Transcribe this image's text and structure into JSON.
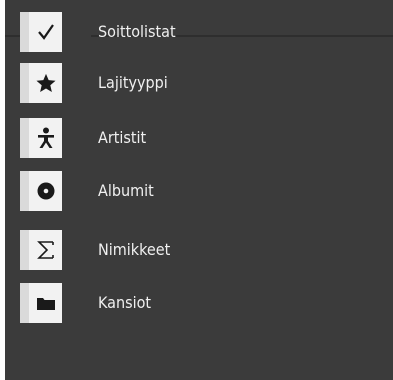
{
  "menu": {
    "items": [
      {
        "label": "Soittolistat",
        "icon": "checkmark-icon"
      },
      {
        "label": "Lajityyppi",
        "icon": "star-icon"
      },
      {
        "label": "Artistit",
        "icon": "person-icon"
      },
      {
        "label": "Albumit",
        "icon": "disc-icon"
      },
      {
        "label": "Nimikkeet",
        "icon": "sigma-icon"
      },
      {
        "label": "Kansiot",
        "icon": "folder-icon"
      }
    ]
  },
  "colors": {
    "background": "#3b3b3b",
    "tile": "#f2f2f2",
    "tile_strip": "#dadada",
    "icon": "#1a1a1a",
    "label": "#f0f0f0"
  }
}
